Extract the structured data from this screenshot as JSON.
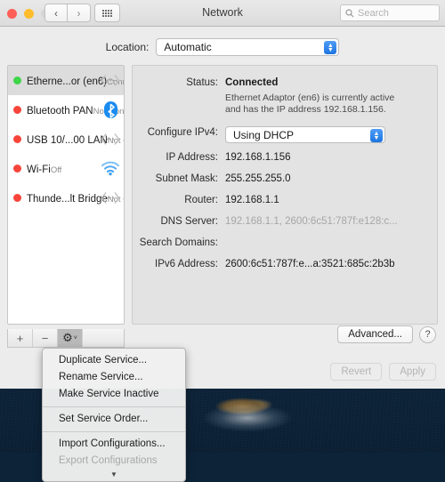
{
  "window": {
    "title": "Network",
    "traffic_lights": [
      "close",
      "minimize",
      "zoom"
    ],
    "nav_back": "‹",
    "nav_forward": "›",
    "grid_icon": "grid-icon",
    "search_placeholder": "Search"
  },
  "location": {
    "label": "Location:",
    "value": "Automatic"
  },
  "services": [
    {
      "name": "Etherne...or (en6)",
      "status": "Connected",
      "dot": "green",
      "icon": "ethernet-icon",
      "selected": true
    },
    {
      "name": "Bluetooth PAN",
      "status": "Not Connected",
      "dot": "red",
      "icon": "bluetooth-icon",
      "selected": false
    },
    {
      "name": "USB 10/...00 LAN",
      "status": "Not Connected",
      "dot": "red",
      "icon": "ethernet-icon",
      "selected": false
    },
    {
      "name": "Wi-Fi",
      "status": "Off",
      "dot": "red",
      "icon": "wifi-icon",
      "selected": false
    },
    {
      "name": "Thunde...lt Bridge",
      "status": "Not Connected",
      "dot": "red",
      "icon": "ethernet-icon",
      "selected": false
    }
  ],
  "detail": {
    "status_label": "Status:",
    "status_value": "Connected",
    "status_description": "Ethernet Adaptor (en6) is currently active and has the IP address 192.168.1.156.",
    "configure_label": "Configure IPv4:",
    "configure_value": "Using DHCP",
    "ip_label": "IP Address:",
    "ip_value": "192.168.1.156",
    "subnet_label": "Subnet Mask:",
    "subnet_value": "255.255.255.0",
    "router_label": "Router:",
    "router_value": "192.168.1.1",
    "dns_label": "DNS Server:",
    "dns_value": "192.168.1.1, 2600:6c51:787f:e128:c...",
    "search_domains_label": "Search Domains:",
    "search_domains_value": "",
    "ipv6_label": "IPv6 Address:",
    "ipv6_value": "2600:6c51:787f:e...a:3521:685c:2b3b"
  },
  "toolbar": {
    "add_label": "+",
    "remove_label": "−",
    "gear_label": "⚙",
    "gear_chevron": "˅"
  },
  "buttons": {
    "advanced": "Advanced...",
    "help": "?",
    "revert": "Revert",
    "apply": "Apply"
  },
  "context_menu": {
    "items": [
      {
        "label": "Duplicate Service...",
        "dim": false,
        "separator_after": false
      },
      {
        "label": "Rename Service...",
        "dim": false,
        "separator_after": false
      },
      {
        "label": "Make Service Inactive",
        "dim": false,
        "separator_after": true
      },
      {
        "label": "Set Service Order...",
        "dim": false,
        "separator_after": true
      },
      {
        "label": "Import Configurations...",
        "dim": false,
        "separator_after": false
      },
      {
        "label": "Export Configurations",
        "dim": true,
        "separator_after": false
      }
    ],
    "scroll_indicator": "▼"
  },
  "colors": {
    "accent_blue": "#1c74e0",
    "connected_green": "#3dd649",
    "disconnected_red": "#f8453a",
    "bluetooth_blue": "#1a8cf0",
    "wifi_blue": "#3e9ff0"
  }
}
